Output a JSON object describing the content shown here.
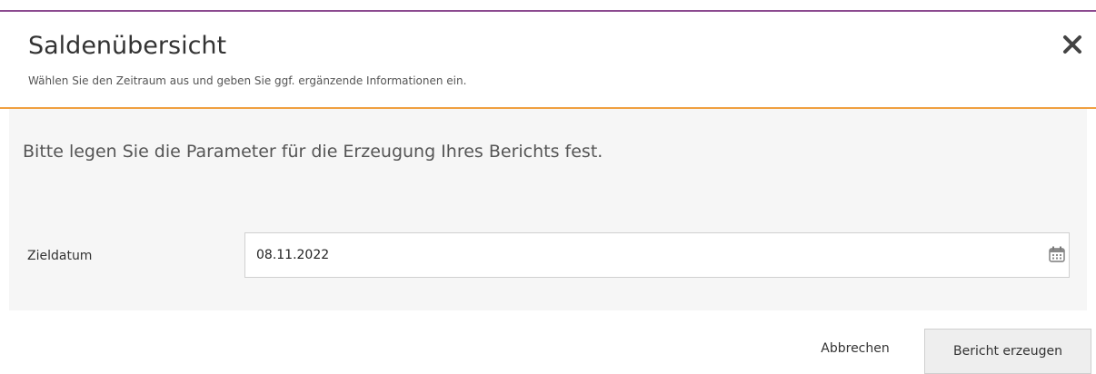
{
  "dialog": {
    "title": "Saldenübersicht",
    "subtitle": "Wählen Sie den Zeitraum aus und geben Sie ggf. ergänzende Informationen ein.",
    "close_icon": "close-icon",
    "accent_top": "#8b4a8f",
    "accent_divider": "#f0a040"
  },
  "form": {
    "instruction": "Bitte legen Sie die Parameter für die Erzeugung Ihres Berichts fest.",
    "fields": [
      {
        "label": "Zieldatum",
        "value": "08.11.2022",
        "icon": "calendar-icon"
      }
    ]
  },
  "footer": {
    "cancel_label": "Abbrechen",
    "submit_label": "Bericht erzeugen"
  }
}
